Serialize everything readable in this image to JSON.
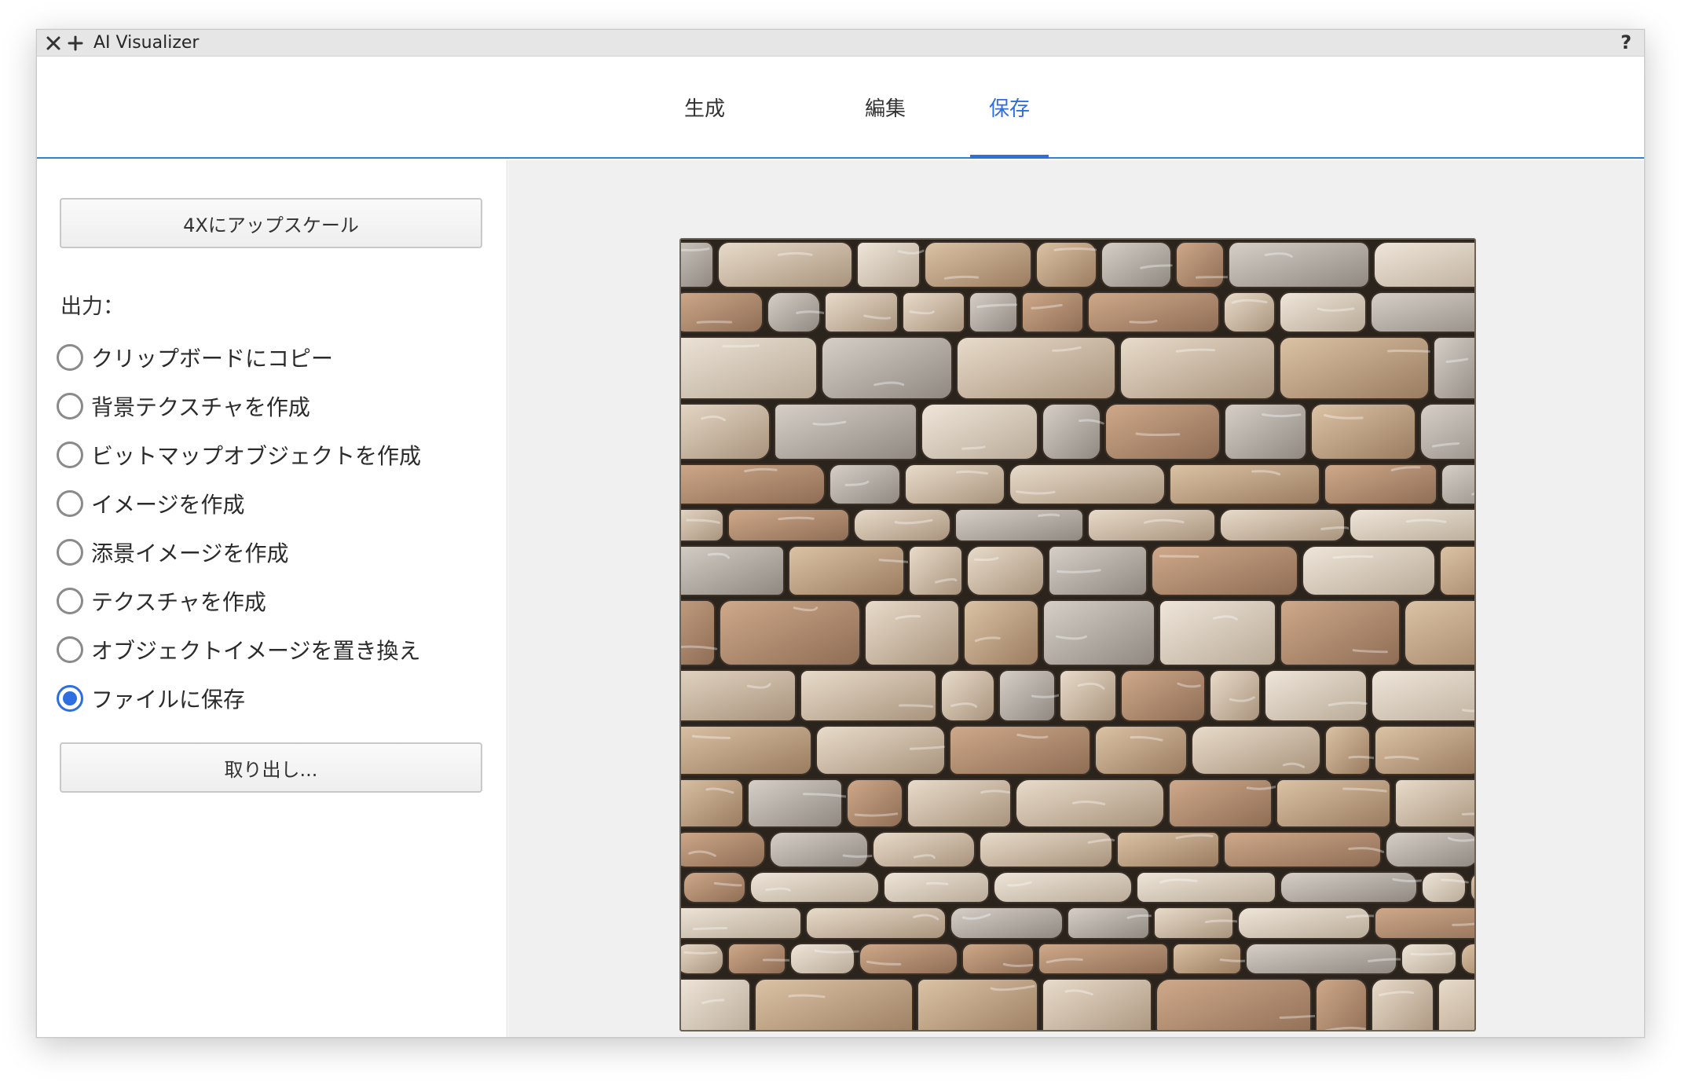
{
  "window": {
    "title": "AI Visualizer",
    "help_label": "?",
    "icons": {
      "close": "close-icon",
      "add": "plus-icon"
    }
  },
  "tabs": [
    {
      "label": "生成",
      "active": false
    },
    {
      "label": "編集",
      "active": false
    },
    {
      "label": "保存",
      "active": true
    }
  ],
  "left": {
    "upscale_button": "4Xにアップスケール",
    "output_label": "出力：",
    "options": [
      {
        "label": "クリップボードにコピー",
        "checked": false
      },
      {
        "label": "背景テクスチャを作成",
        "checked": false
      },
      {
        "label": "ビットマップオブジェクトを作成",
        "checked": false
      },
      {
        "label": "イメージを作成",
        "checked": false
      },
      {
        "label": "添景イメージを作成",
        "checked": false
      },
      {
        "label": "テクスチャを作成",
        "checked": false
      },
      {
        "label": "オブジェクトイメージを置き換え",
        "checked": false
      },
      {
        "label": "ファイルに保存",
        "checked": true
      }
    ],
    "export_button": "取り出し..."
  },
  "preview": {
    "subject": "stone-wall-texture-image"
  },
  "colors": {
    "accent": "#2f6ee0",
    "panel_bg": "#f0f0f0",
    "titlebar_bg": "#e6e6e6"
  }
}
